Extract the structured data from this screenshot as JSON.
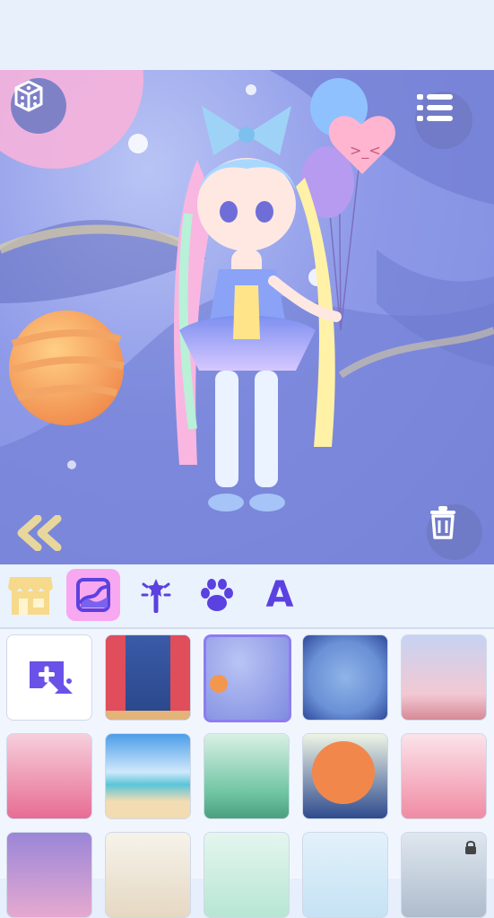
{
  "screen": {
    "name": "doll-dressup-background-editor"
  },
  "scene": {
    "dice_icon": "dice-icon",
    "menu_icon": "list-menu-icon",
    "collapse_icon": "double-chevron-left-icon",
    "trash_icon": "trash-icon"
  },
  "toolbar": {
    "tabs": [
      {
        "icon": "shop-icon",
        "active": false
      },
      {
        "icon": "background-image-icon",
        "active": true
      },
      {
        "icon": "magic-wand-icon",
        "active": false
      },
      {
        "icon": "paw-icon",
        "active": false
      },
      {
        "icon": "text-a-icon",
        "active": false
      },
      {
        "label": "A"
      }
    ]
  },
  "backgrounds": {
    "add_icon": "add-photo-icon",
    "lock_icon": "lock-icon",
    "selected_index": 2
  },
  "colors": {
    "accent": "#f7a8f0",
    "primary": "#6a52e8",
    "selected_border": "#8f7cf0"
  }
}
